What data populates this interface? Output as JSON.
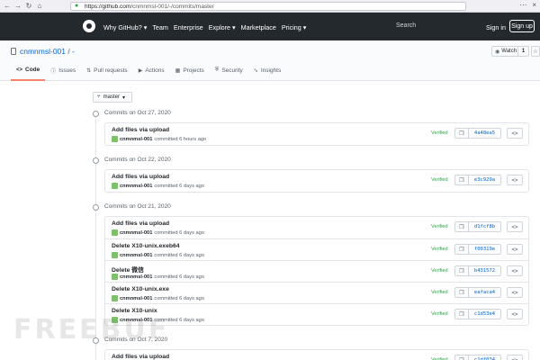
{
  "browser": {
    "back": "←",
    "forward": "→",
    "reload": "↻",
    "home": "⌂",
    "url_host": "https://github.com",
    "url_path": "/cnmnmsl-001/-/commits/master",
    "menu": "⋯",
    "window_close": "×"
  },
  "gh_nav": {
    "items": [
      "Why GitHub? ▾",
      "Team",
      "Enterprise",
      "Explore ▾",
      "Marketplace",
      "Pricing ▾"
    ],
    "search": "Search",
    "sign_in": "Sign in",
    "sign_up": "Sign up"
  },
  "repo": {
    "owner": "cnmnmsl-001",
    "separator": "/",
    "name": "-",
    "watch_label": "Watch",
    "watch_count": "1",
    "tabs": [
      {
        "icon": "<>",
        "label": "Code",
        "active": true
      },
      {
        "icon": "ⓘ",
        "label": "Issues"
      },
      {
        "icon": "⇅",
        "label": "Pull requests"
      },
      {
        "icon": "▶",
        "label": "Actions"
      },
      {
        "icon": "▦",
        "label": "Projects"
      },
      {
        "icon": "⛨",
        "label": "Security"
      },
      {
        "icon": "∿",
        "label": "Insights"
      }
    ]
  },
  "branch": {
    "label": "master"
  },
  "days": [
    {
      "label": "Commits on Oct 27, 2020",
      "commits": [
        {
          "message": "Add files via upload",
          "author": "cnmnmsl-001",
          "when": "committed 6 hours ago",
          "verified": "Verified",
          "sha": "4a48ea5"
        }
      ]
    },
    {
      "label": "Commits on Oct 22, 2020",
      "commits": [
        {
          "message": "Add files via upload",
          "author": "cnmnmsl-001",
          "when": "committed 6 days ago",
          "verified": "Verified",
          "sha": "e3c929a"
        }
      ]
    },
    {
      "label": "Commits on Oct 21, 2020",
      "commits": [
        {
          "message": "Add files via upload",
          "author": "cnmnmsl-001",
          "when": "committed 6 days ago",
          "verified": "Verified",
          "sha": "d1fcf8b"
        },
        {
          "message": "Delete X10-unix.exeb64",
          "author": "cnmnmsl-001",
          "when": "committed 6 days ago",
          "verified": "Verified",
          "sha": "f00319e"
        },
        {
          "message": "Delete 微信",
          "author": "cnmnmsl-001",
          "when": "committed 6 days ago",
          "verified": "Verified",
          "sha": "b431572"
        },
        {
          "message": "Delete X10-unix.exe",
          "author": "cnmnmsl-001",
          "when": "committed 6 days ago",
          "verified": "Verified",
          "sha": "eafaca4"
        },
        {
          "message": "Delete X10-unix",
          "author": "cnmnmsl-001",
          "when": "committed 6 days ago",
          "verified": "Verified",
          "sha": "c1d53e4"
        }
      ]
    },
    {
      "label": "Commits on Oct 7, 2020",
      "commits": [
        {
          "message": "Add files via upload",
          "author": "cnmnmsl-001",
          "when": "committed 20 days ago",
          "verified": "Verified",
          "sha": "c1df034"
        }
      ]
    }
  ],
  "watermark": "FREEBUF"
}
